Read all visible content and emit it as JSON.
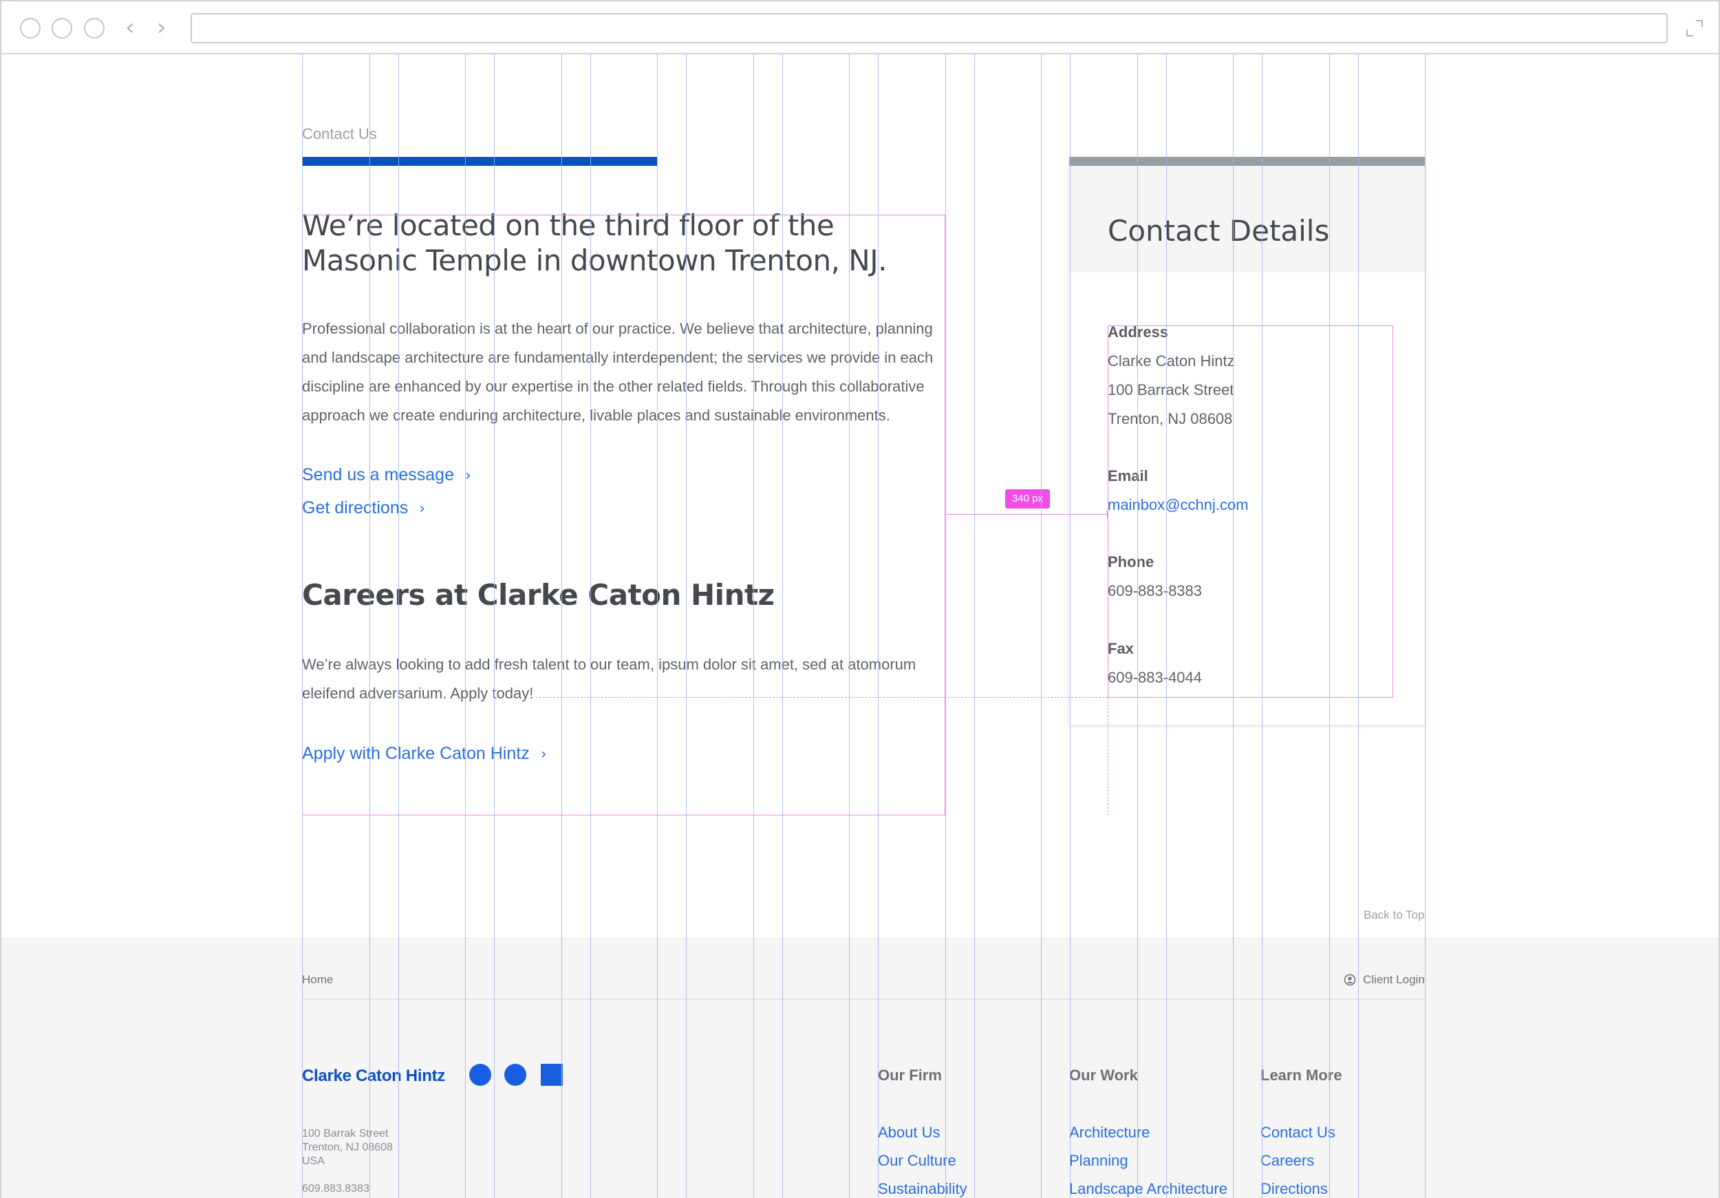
{
  "browser": {
    "back_arrow": "‹",
    "forward_arrow": "›"
  },
  "header": {
    "breadcrumb": "Contact Us"
  },
  "main": {
    "headline": "We’re located on the third floor of the Masonic Temple in downtown Trenton, NJ.",
    "intro": "Professional collaboration is at the heart of our practice. We believe that architecture, planning and landscape architecture are fundamentally interdependent; the services we provide in each discipline are enhanced by our expertise in the other related fields. Through this collaborative approach we create enduring architecture, livable places and sustainable environments.",
    "links": {
      "message": "Send us a message",
      "directions": "Get directions",
      "apply": "Apply with Clarke Caton Hintz"
    },
    "careers_heading": "Careers at Clarke Caton Hintz",
    "careers_text": "We’re always looking to add fresh talent to our team, ipsum dolor sit amet, sed at atomorum eleifend adversarium. Apply today!",
    "chevron": "›"
  },
  "annotation": {
    "spacing_label": "340 px"
  },
  "contact_card": {
    "title": "Contact Details",
    "address_label": "Address",
    "address_lines": [
      "Clarke Caton Hintz",
      "100 Barrack Street",
      "Trenton, NJ 08608"
    ],
    "email_label": "Email",
    "email": "mainbox@cchnj.com",
    "phone_label": "Phone",
    "phone": "609-883-8383",
    "fax_label": "Fax",
    "fax": "609-883-4044"
  },
  "back_to_top": "Back to Top",
  "footer": {
    "home": "Home",
    "client_login": "Client Login",
    "brand": "Clarke Caton Hintz",
    "address_lines": [
      "100 Barrak Street",
      "Trenton, NJ 08608",
      "USA"
    ],
    "phone": "609.883.8383",
    "columns": [
      {
        "heading": "Our Firm",
        "links": [
          "About Us",
          "Our Culture",
          "Sustainability"
        ]
      },
      {
        "heading": "Our Work",
        "links": [
          "Architecture",
          "Planning",
          "Landscape Architecture"
        ]
      },
      {
        "heading": "Learn More",
        "links": [
          "Contact Us",
          "Careers",
          "Directions"
        ]
      }
    ]
  },
  "colors": {
    "brand_blue": "#0b50c0",
    "link_blue": "#2a6fdd",
    "grid_blue": "#9fb6ea",
    "guide_pink": "#e48ae8",
    "badge_pink": "#ee4de8",
    "card_bar_gray": "#979ea3"
  }
}
